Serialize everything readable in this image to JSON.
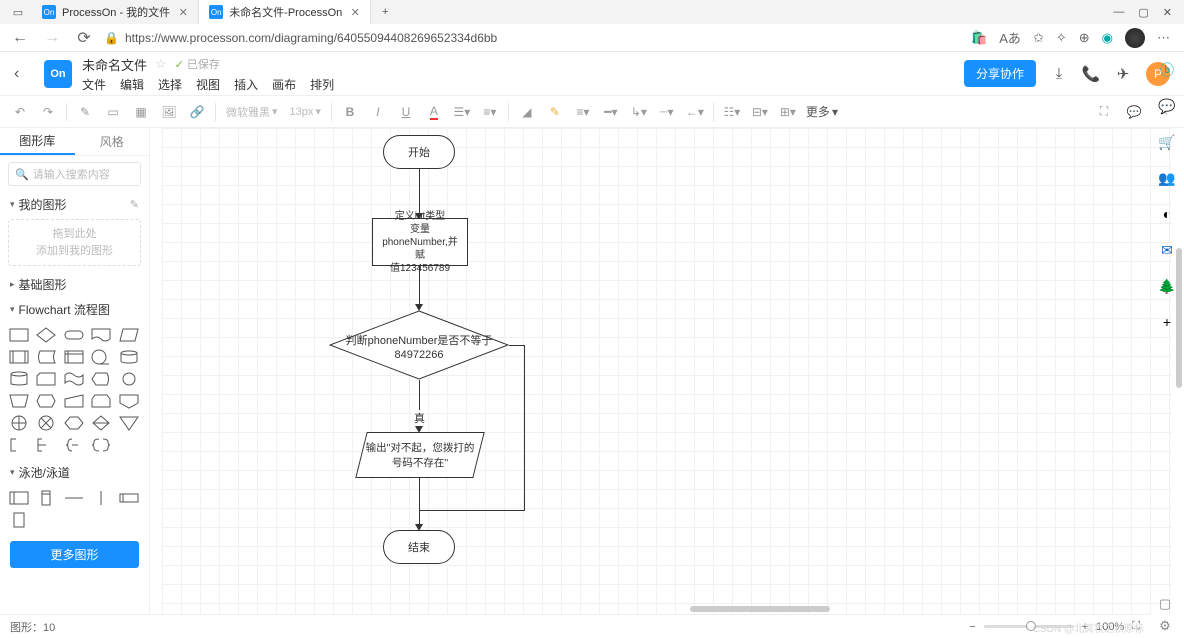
{
  "browser": {
    "tabs": [
      {
        "title": "ProcessOn - 我的文件"
      },
      {
        "title": "未命名文件-ProcessOn"
      }
    ],
    "url": "https://www.processon.com/diagraming/64055094408269652334d6bb"
  },
  "app": {
    "logo": "On",
    "doc_title": "未命名文件",
    "saved": "已保存",
    "menus": [
      "文件",
      "编辑",
      "选择",
      "视图",
      "插入",
      "画布",
      "排列"
    ],
    "share": "分享协作",
    "user_initial": "P"
  },
  "toolbar": {
    "font": "微软雅黑",
    "font_size": "13px",
    "more": "更多"
  },
  "sidebar": {
    "tabs": {
      "shapes": "图形库",
      "style": "风格"
    },
    "search_placeholder": "请输入搜索内容",
    "my_shapes": "我的图形",
    "drop_line1": "拖到此处",
    "drop_line2": "添加到我的图形",
    "basic": "基础图形",
    "flowchart": "Flowchart 流程图",
    "pool": "泳池/泳道",
    "more_shapes": "更多图形"
  },
  "flow": {
    "start": "开始",
    "define": "定义int类型\n变量\nphoneNumber,并赋\n值123456789",
    "decision": "判断phoneNumber是否不等于\n84972266",
    "true_label": "真",
    "output": "输出\"对不起，您拨打的\n号码不存在\"",
    "end": "结束"
  },
  "status": {
    "shapes_label": "图形：",
    "shapes_count": "10",
    "zoom": "100%",
    "watermark": "CSDN @北冥牧之秋原标"
  }
}
